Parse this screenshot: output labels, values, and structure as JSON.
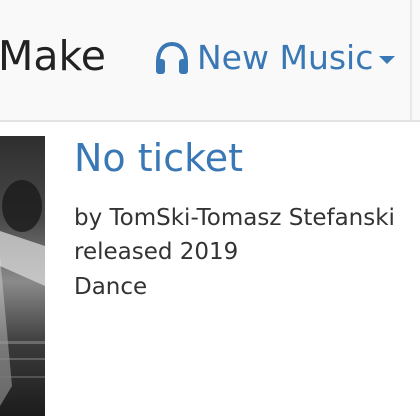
{
  "navbar": {
    "brand_text": "Make",
    "music_menu": {
      "label": "New Music",
      "icon": "headphones-icon",
      "dropdown_icon": "caret-down-icon"
    }
  },
  "release": {
    "title": "No ticket",
    "artist_line": "by TomSki-Tomasz Stefanski",
    "released_line": "released 2019",
    "genre": "Dance"
  },
  "colors": {
    "accent": "#3a78b5",
    "text": "#333333",
    "navbar_bg": "#f9f9f9"
  }
}
